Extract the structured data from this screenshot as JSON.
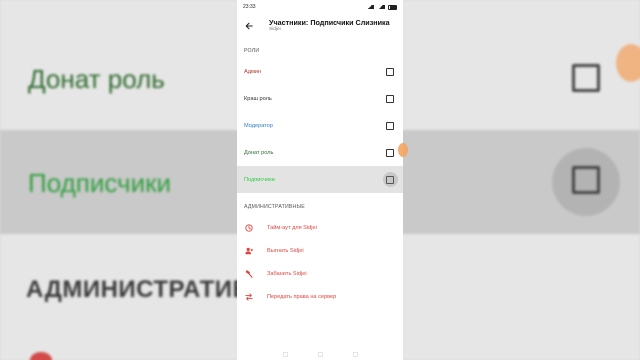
{
  "status_bar": {
    "time": "23:33"
  },
  "header": {
    "title": "Участники: Подписчики Слизника",
    "subtitle": "Sidjei"
  },
  "roles_section": {
    "label": "РОЛИ",
    "items": [
      {
        "label": "Админ",
        "color": "#b03a2e",
        "checked": false,
        "selected": false
      },
      {
        "label": "Краш роль",
        "color": "#333333",
        "checked": false,
        "selected": false
      },
      {
        "label": "Модератор",
        "color": "#2f7fc9",
        "checked": false,
        "selected": false
      },
      {
        "label": "Донат роль",
        "color": "#2e6a2e",
        "checked": false,
        "selected": false
      },
      {
        "label": "Подписчики",
        "color": "#2ecc40",
        "checked": false,
        "selected": true
      }
    ]
  },
  "admin_section": {
    "label": "АДМИНИСТРАТИВНЫЕ",
    "actions": [
      {
        "label": "Тайм-аут для Sidjei",
        "icon": "clock-icon"
      },
      {
        "label": "Выгнать Sidjei",
        "icon": "kick-user-icon"
      },
      {
        "label": "Забанить Sidjei",
        "icon": "ban-hammer-icon"
      },
      {
        "label": "Передать права на сервер",
        "icon": "transfer-arrows-icon"
      }
    ]
  },
  "background": {
    "row1_label": "Донат роль",
    "row2_label": "Подписчики",
    "section_label": "АДМИНИСТРАТИВН"
  },
  "colors": {
    "danger": "#e0443e",
    "selected_row": "#e3e3e3"
  }
}
